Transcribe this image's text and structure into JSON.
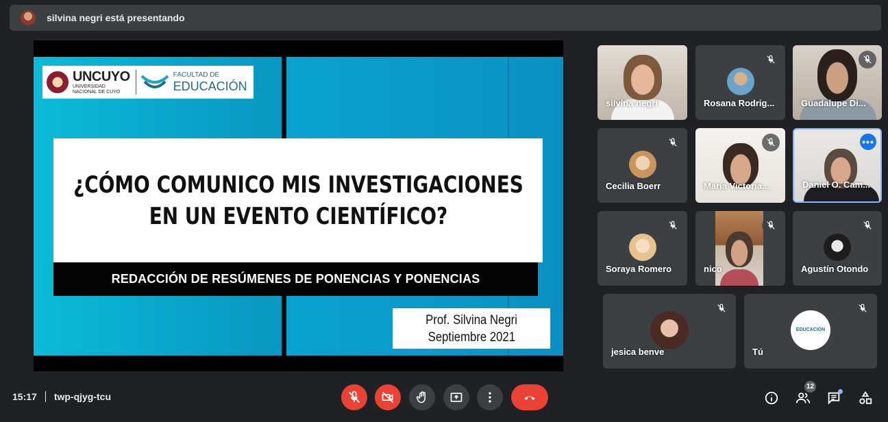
{
  "banner": {
    "text": "silvina negri está presentando"
  },
  "slide": {
    "university": {
      "title": "UNCUYO",
      "line1": "UNIVERSIDAD",
      "line2": "NACIONAL DE CUYO"
    },
    "faculty": {
      "small": "FACULTAD DE",
      "big": "EDUCACIÓN"
    },
    "title_line1": "¿CÓMO COMUNICO MIS INVESTIGACIONES",
    "title_line2": "EN UN EVENTO CIENTÍFICO?",
    "subtitle": "REDACCIÓN DE RESÚMENES DE PONENCIAS Y PONENCIAS",
    "author": "Prof. Silvina Negri",
    "date": "Septiembre 2021"
  },
  "participants": [
    {
      "name": "silvina negri",
      "muted": false,
      "video": true
    },
    {
      "name": "Rosana Rodrig...",
      "muted": true,
      "video": false,
      "avatar_color": "#6aa4c9"
    },
    {
      "name": "Guadalupe Di...",
      "muted": true,
      "video": true
    },
    {
      "name": "Cecilia Boerr",
      "muted": true,
      "video": false,
      "avatar_color": "#e0b48f"
    },
    {
      "name": "María Victoria...",
      "muted": true,
      "video": true
    },
    {
      "name": "Daniel O. Cam...",
      "muted": false,
      "video": true,
      "active": true
    },
    {
      "name": "Soraya Romero",
      "muted": true,
      "video": false,
      "avatar_color": "#e8c9a4"
    },
    {
      "name": "nico",
      "muted": true,
      "video": true
    },
    {
      "name": "Agustín Otondo",
      "muted": true,
      "video": false,
      "avatar_color": "#2a2a2a"
    },
    {
      "name": "jesica benve",
      "muted": true,
      "video": false,
      "avatar_color": "#9a5a40"
    },
    {
      "name": "Tú",
      "muted": true,
      "video": false,
      "avatar_text": "EDUCACIÓN"
    }
  ],
  "bottom_bar": {
    "time": "15:17",
    "meeting_code": "twp-qjyg-tcu",
    "participant_count": "12"
  },
  "icons": {
    "mic_off": "mic-off-icon",
    "cam_off": "videocam-off-icon",
    "raise_hand": "hand-icon",
    "present": "present-icon",
    "more": "more-vert-icon",
    "end_call": "call-end-icon",
    "info": "info-icon",
    "people": "people-icon",
    "chat": "chat-icon",
    "activities": "activities-icon"
  },
  "colors": {
    "red": "#ea4335",
    "bg": "#202124",
    "tile": "#3c4043",
    "accent": "#8ab4f8"
  }
}
